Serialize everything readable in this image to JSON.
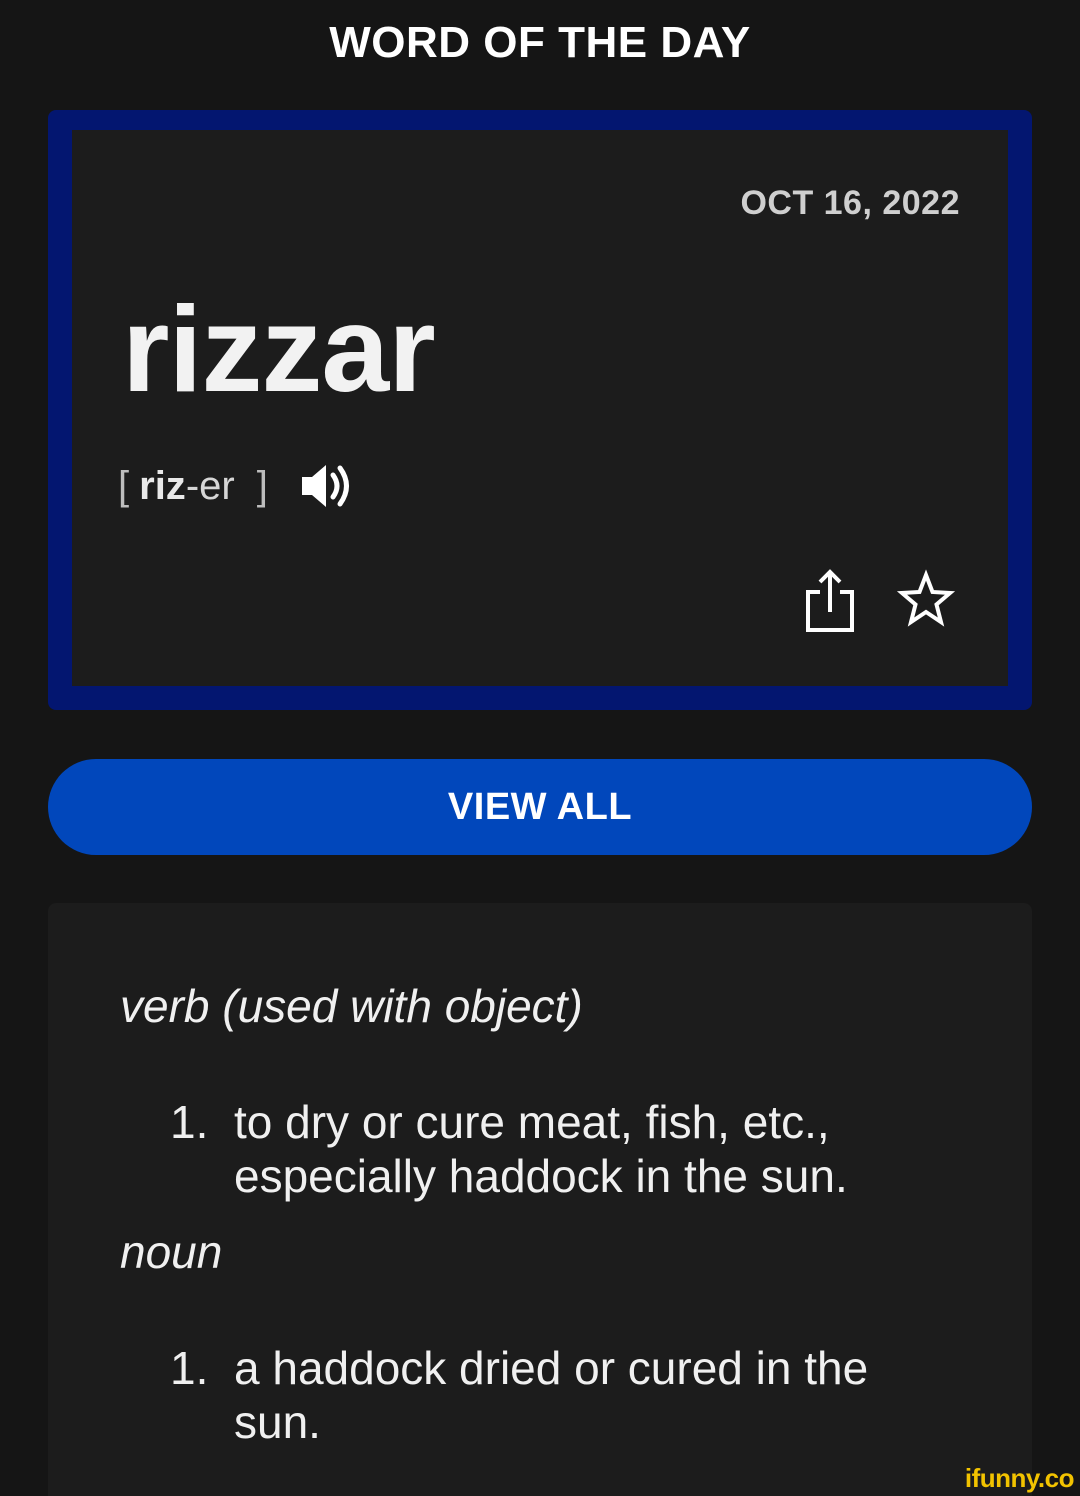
{
  "header": {
    "title": "WORD OF THE DAY"
  },
  "wotd": {
    "date": "OCT 16, 2022",
    "word": "rizzar",
    "pronunciation": {
      "open_bracket": "[",
      "stressed": "riz",
      "rest": "-er",
      "close_bracket": "]"
    },
    "icons": {
      "speaker": "speaker-icon",
      "share": "share-icon",
      "favorite": "star-icon"
    }
  },
  "view_all_label": "VIEW ALL",
  "definitions": {
    "verb": {
      "pos": "verb (used with object)",
      "items": [
        {
          "num": "1.",
          "text": "to dry or cure meat, fish, etc., especially haddock in the sun."
        }
      ]
    },
    "noun": {
      "pos": "noun",
      "items": [
        {
          "num": "1.",
          "text": "a haddock dried or cured in the sun."
        }
      ]
    }
  },
  "watermark": "ifunny.co",
  "colors": {
    "background": "#151515",
    "card_border": "#031670",
    "card_bg": "#1c1c1c",
    "button": "#0147bb",
    "watermark": "#f2c300"
  }
}
